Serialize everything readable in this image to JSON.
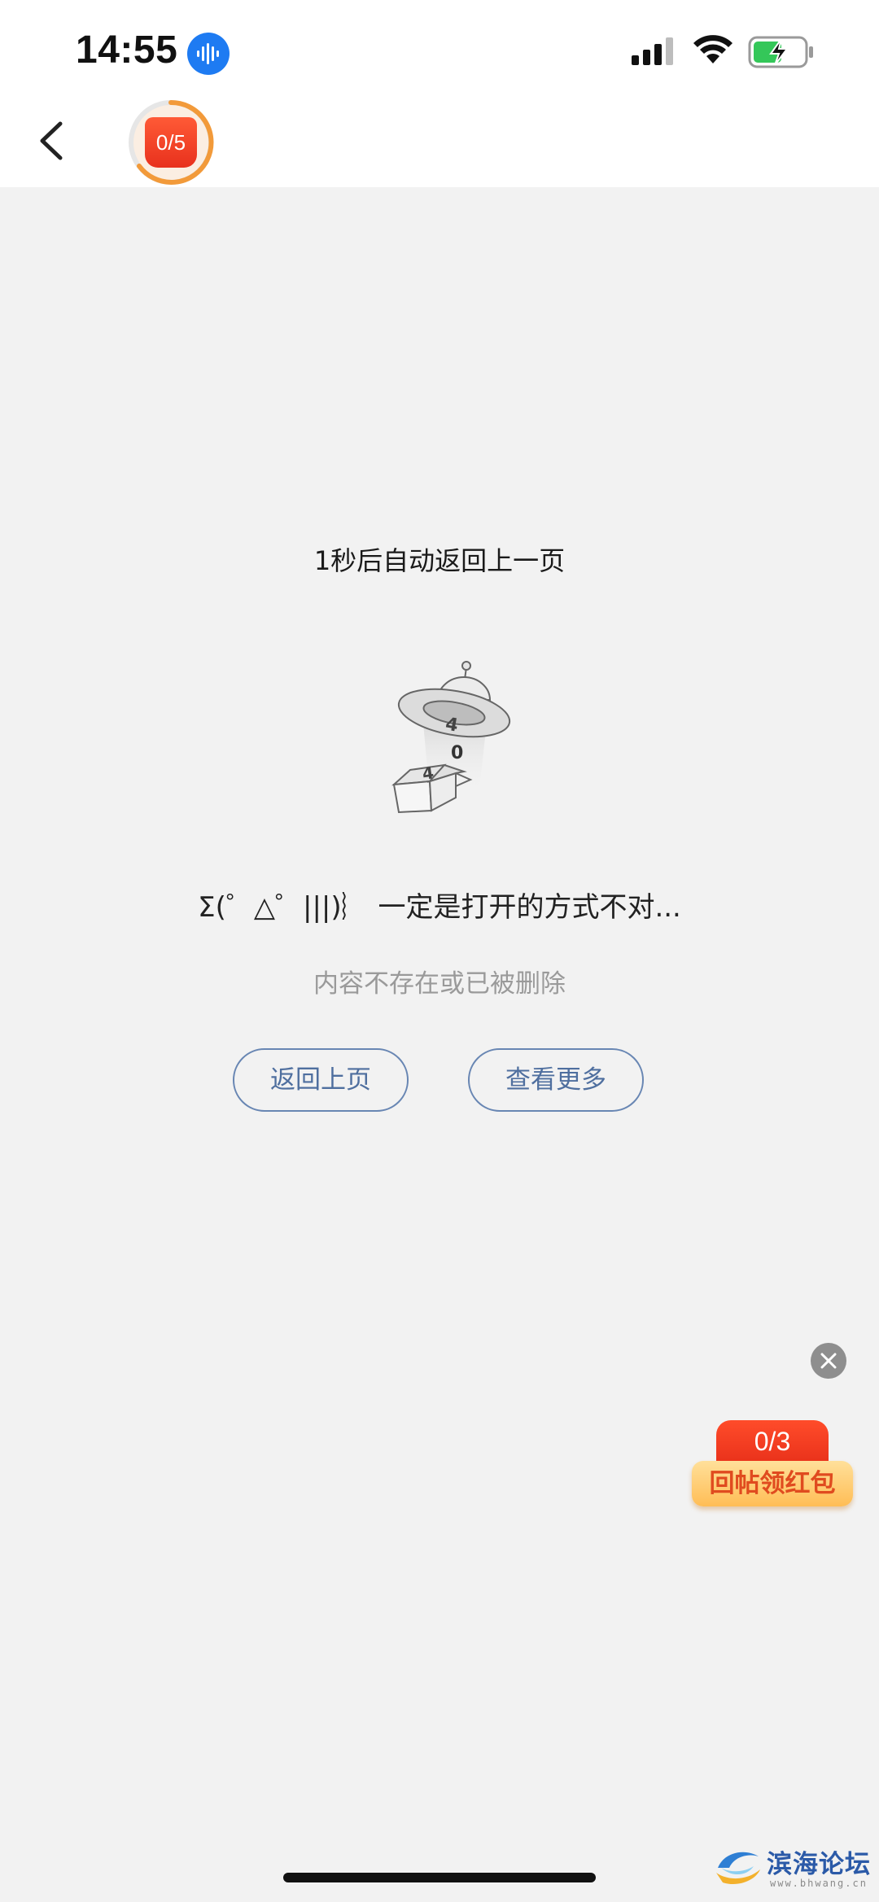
{
  "status_bar": {
    "time": "14:55",
    "battery_icon": "battery-charging-icon",
    "signal_icon": "cellular-signal-icon",
    "wifi_icon": "wifi-icon",
    "voice_icon": "voice-wave-icon"
  },
  "nav": {
    "back_icon": "chevron-left-icon",
    "task_progress": "0/5",
    "task_progress_fraction": 0.0
  },
  "content": {
    "countdown_text": "1秒后自动返回上一页",
    "illustration_icon": "ufo-404-icon",
    "error_title": "Σ(゜△゜|||)︴ 一定是打开的方式不对...",
    "error_subtitle": "内容不存在或已被删除",
    "back_button": "返回上页",
    "more_button": "查看更多"
  },
  "reward": {
    "count": "0/3",
    "label": "回帖领红包"
  },
  "watermark": {
    "name": "滨海论坛",
    "url": "www.bhwang.cn"
  },
  "colors": {
    "background": "#f2f2f2",
    "button_border": "#6886b3",
    "accent_red": "#e8311d",
    "accent_orange": "#f29a3a"
  }
}
